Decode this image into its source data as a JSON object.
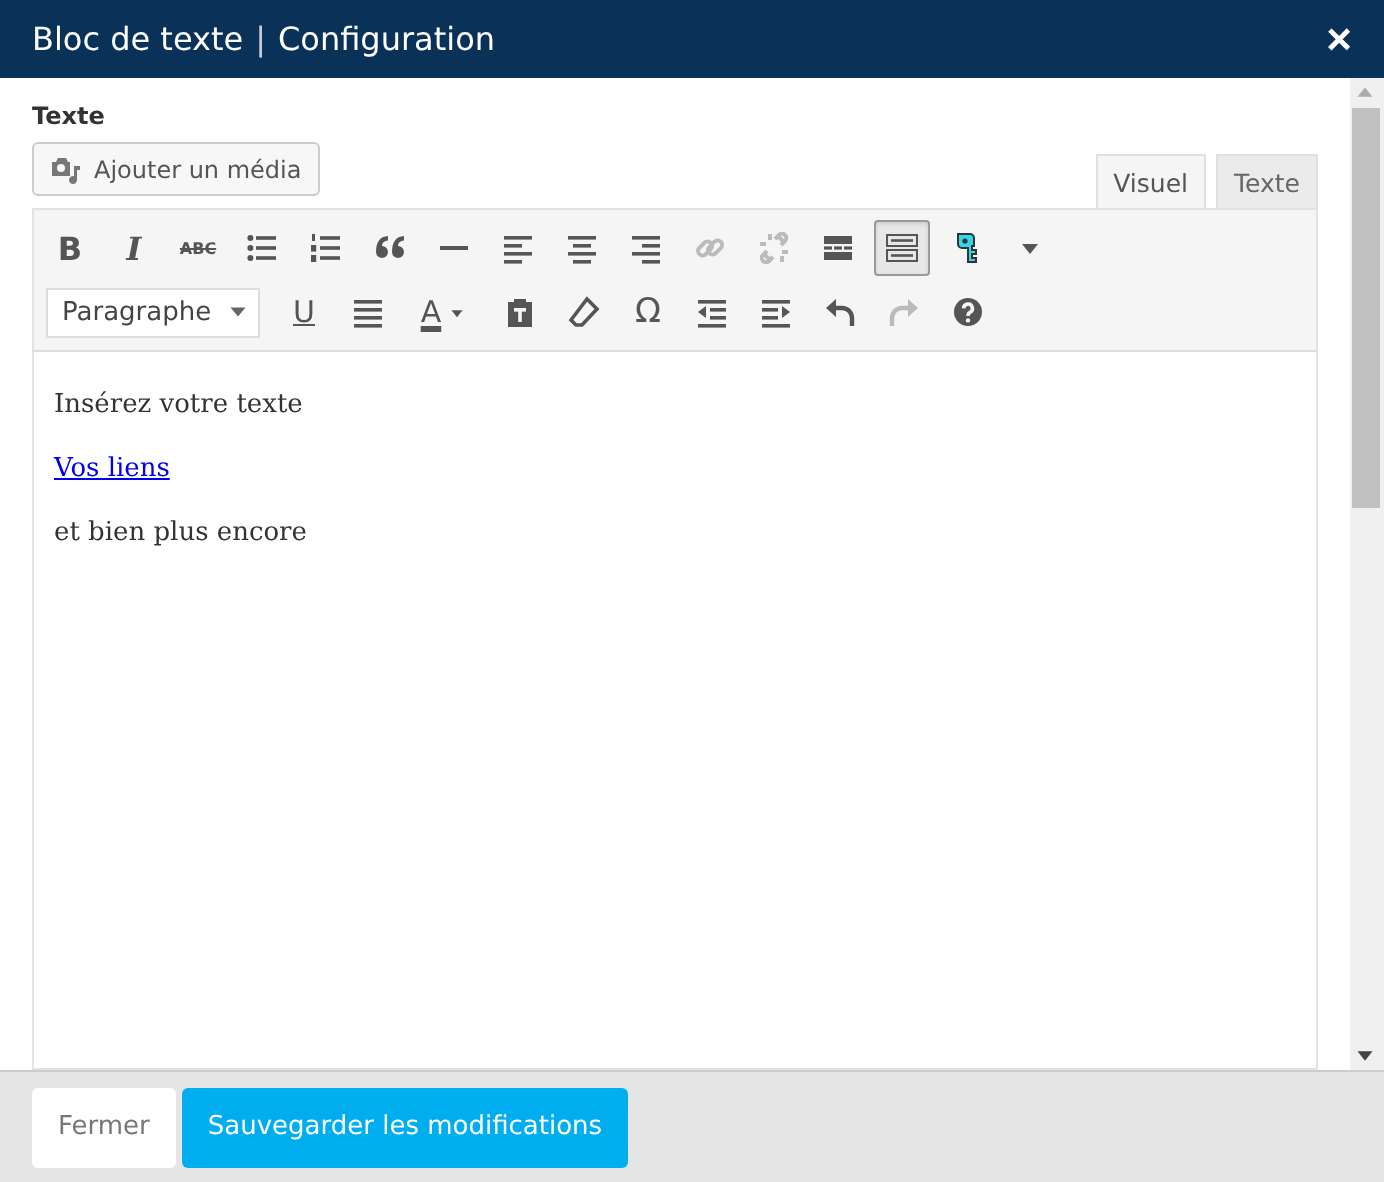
{
  "window": {
    "title": "Bloc de texte",
    "separator": "|",
    "subtitle": "Configuration",
    "close": "×"
  },
  "field_label": "Texte",
  "media_button": "Ajouter un média",
  "tabs": [
    {
      "label": "Visuel",
      "selected": true
    },
    {
      "label": "Texte",
      "selected": false
    }
  ],
  "toolbar_rows": [
    [
      {
        "kind": "bold",
        "text": "B"
      },
      {
        "kind": "italic",
        "text": "I"
      },
      {
        "kind": "strike",
        "text": "ABC"
      },
      {
        "kind": "icon",
        "disabled": false,
        "pressed": false
      },
      {
        "kind": "icon",
        "disabled": false,
        "pressed": false
      },
      {
        "kind": "icon",
        "disabled": false,
        "pressed": false
      },
      {
        "kind": "icon",
        "disabled": false,
        "pressed": false
      },
      {
        "kind": "icon",
        "disabled": false,
        "pressed": false
      },
      {
        "kind": "icon",
        "disabled": false,
        "pressed": false
      },
      {
        "kind": "icon",
        "disabled": false,
        "pressed": false
      },
      {
        "kind": "icon",
        "disabled": true,
        "pressed": false
      },
      {
        "kind": "icon",
        "disabled": true,
        "pressed": false
      },
      {
        "kind": "icon",
        "disabled": false,
        "pressed": false
      },
      {
        "kind": "icon",
        "disabled": false,
        "pressed": true
      },
      {
        "kind": "icon",
        "disabled": false,
        "pressed": false
      },
      {
        "kind": "icon",
        "disabled": false,
        "pressed": false
      }
    ],
    [
      {
        "kind": "select",
        "text": "Paragraphe"
      },
      {
        "kind": "underline",
        "text": "U"
      },
      {
        "kind": "icon",
        "disabled": false,
        "pressed": false
      },
      {
        "kind": "color",
        "text": "A"
      },
      {
        "kind": "icon",
        "disabled": false,
        "pressed": false
      },
      {
        "kind": "icon",
        "disabled": false,
        "pressed": false
      },
      {
        "kind": "symbol",
        "text": "Ω"
      },
      {
        "kind": "icon",
        "disabled": false,
        "pressed": false
      },
      {
        "kind": "icon",
        "disabled": false,
        "pressed": false
      },
      {
        "kind": "icon",
        "disabled": false,
        "pressed": false
      },
      {
        "kind": "icon",
        "disabled": true,
        "pressed": false
      },
      {
        "kind": "icon",
        "disabled": false,
        "pressed": false
      }
    ]
  ],
  "content": [
    {
      "kind": "paragraph",
      "text": "Insérez votre texte"
    },
    {
      "kind": "link",
      "text": "Vos liens"
    },
    {
      "kind": "paragraph",
      "text": "et bien plus encore"
    }
  ],
  "buttons": [
    {
      "label": "Fermer",
      "kind": "secondary"
    },
    {
      "label": "Sauvegarder les modifications",
      "kind": "primary"
    }
  ]
}
